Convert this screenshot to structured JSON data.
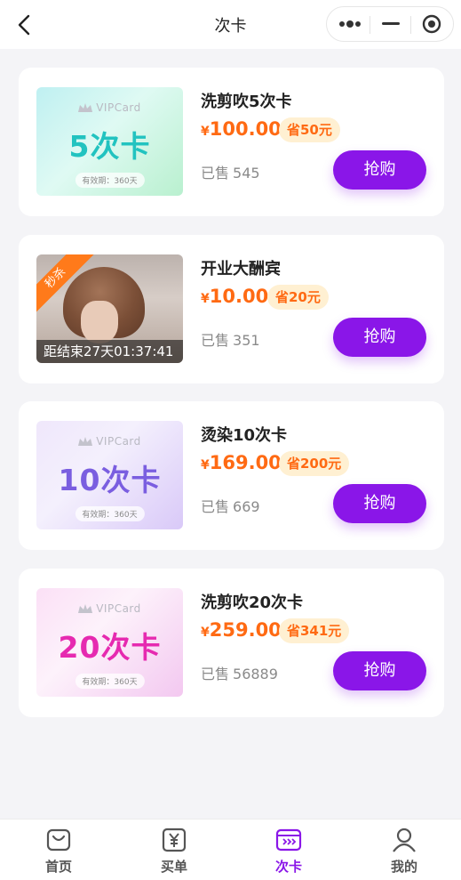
{
  "header": {
    "title": "次卡"
  },
  "products": [
    {
      "name": "洗剪吹5次卡",
      "currency": "¥",
      "price": "100.00",
      "save": "省50元",
      "sold_label": "已售",
      "sold": "545",
      "buy": "抢购",
      "thumb": {
        "type": "card",
        "brand": "VIPCard",
        "card_title": "5次卡",
        "validity": "有效期：360天",
        "title_color": "#22c3c0"
      }
    },
    {
      "name": "开业大酬宾",
      "currency": "¥",
      "price": "10.00",
      "save": "省20元",
      "sold_label": "已售",
      "sold": "351",
      "buy": "抢购",
      "thumb": {
        "type": "photo",
        "badge": "秒杀",
        "countdown": "距结束27天01:37:41"
      }
    },
    {
      "name": "烫染10次卡",
      "currency": "¥",
      "price": "169.00",
      "save": "省200元",
      "sold_label": "已售",
      "sold": "669",
      "buy": "抢购",
      "thumb": {
        "type": "card",
        "brand": "VIPCard",
        "card_title": "10次卡",
        "validity": "有效期：360天",
        "title_color": "#7a5ee0"
      }
    },
    {
      "name": "洗剪吹20次卡",
      "currency": "¥",
      "price": "259.00",
      "save": "省341元",
      "sold_label": "已售",
      "sold": "56889",
      "buy": "抢购",
      "thumb": {
        "type": "card",
        "brand": "VIPCard",
        "card_title": "20次卡",
        "validity": "有效期：360天",
        "title_color": "#e62ab0"
      }
    }
  ],
  "tabbar": [
    {
      "label": "首页",
      "icon": "bag-icon",
      "active": false
    },
    {
      "label": "买单",
      "icon": "yen-icon",
      "active": false
    },
    {
      "label": "次卡",
      "icon": "card-icon",
      "active": true
    },
    {
      "label": "我的",
      "icon": "user-icon",
      "active": false
    }
  ],
  "colors": {
    "accent": "#8a16e8",
    "price": "#ff6a13",
    "save_bg": "#fff0d2"
  }
}
